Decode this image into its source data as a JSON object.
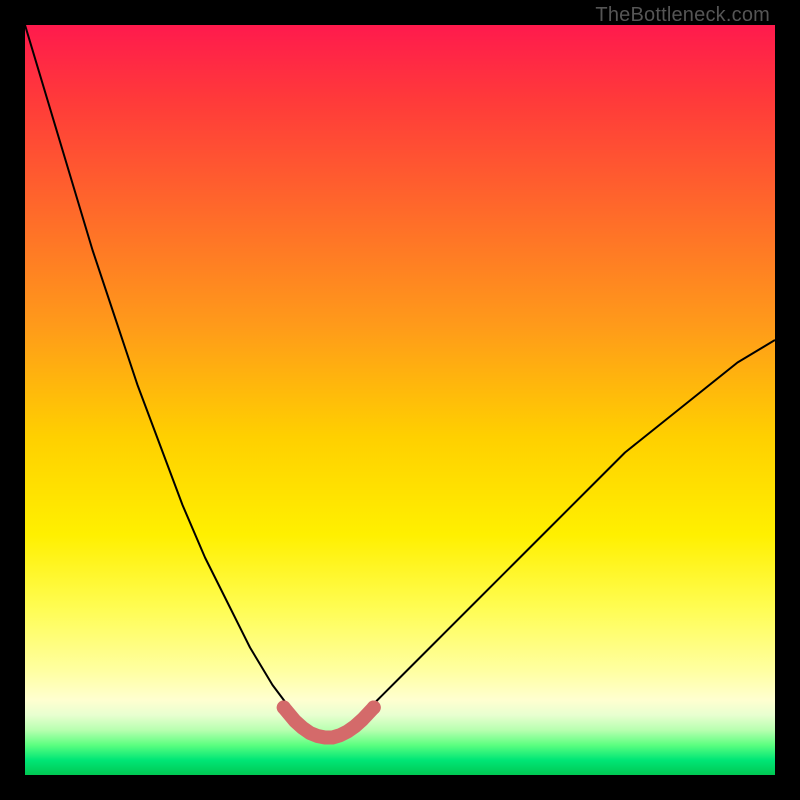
{
  "watermark": "TheBottleneck.com",
  "chart_data": {
    "type": "line",
    "title": "",
    "xlabel": "",
    "ylabel": "",
    "xlim": [
      0,
      100
    ],
    "ylim": [
      0,
      100
    ],
    "grid": false,
    "legend": false,
    "background_gradient": {
      "stops": [
        {
          "pos": 0.0,
          "color": "#ff1a4d"
        },
        {
          "pos": 0.1,
          "color": "#ff3a3a"
        },
        {
          "pos": 0.25,
          "color": "#ff6a2a"
        },
        {
          "pos": 0.4,
          "color": "#ff9a1a"
        },
        {
          "pos": 0.55,
          "color": "#ffd000"
        },
        {
          "pos": 0.68,
          "color": "#fff000"
        },
        {
          "pos": 0.78,
          "color": "#fffd55"
        },
        {
          "pos": 0.86,
          "color": "#ffffa0"
        },
        {
          "pos": 0.9,
          "color": "#ffffd0"
        },
        {
          "pos": 0.92,
          "color": "#e8ffd0"
        },
        {
          "pos": 0.94,
          "color": "#b8ffb0"
        },
        {
          "pos": 0.96,
          "color": "#5cff80"
        },
        {
          "pos": 0.98,
          "color": "#00e676"
        },
        {
          "pos": 1.0,
          "color": "#00c853"
        }
      ]
    },
    "series": [
      {
        "name": "bottleneck-curve",
        "stroke": "#000000",
        "stroke_width": 2,
        "x": [
          0,
          3,
          6,
          9,
          12,
          15,
          18,
          21,
          24,
          27,
          30,
          33,
          36,
          37,
          38,
          39,
          40,
          41,
          42,
          43,
          44,
          45,
          47,
          50,
          55,
          60,
          65,
          70,
          75,
          80,
          85,
          90,
          95,
          100
        ],
        "y": [
          100,
          90,
          80,
          70,
          61,
          52,
          44,
          36,
          29,
          23,
          17,
          12,
          8,
          7,
          6,
          5.5,
          5,
          5,
          5.5,
          6,
          7,
          8,
          10,
          13,
          18,
          23,
          28,
          33,
          38,
          43,
          47,
          51,
          55,
          58
        ]
      },
      {
        "name": "valley-highlight",
        "stroke": "#d46a6a",
        "stroke_width": 14,
        "linecap": "round",
        "x": [
          34.5,
          36,
          37,
          38,
          39,
          40,
          41,
          42,
          43,
          44,
          45,
          46.5
        ],
        "y": [
          9,
          7.2,
          6.3,
          5.6,
          5.2,
          5,
          5,
          5.3,
          5.8,
          6.5,
          7.4,
          9
        ]
      }
    ],
    "markers": [
      {
        "name": "valley-dot-start",
        "x": 34.5,
        "y": 9,
        "r": 7,
        "color": "#d46a6a"
      },
      {
        "name": "valley-dot-end",
        "x": 46.5,
        "y": 9,
        "r": 7,
        "color": "#d46a6a"
      }
    ]
  }
}
